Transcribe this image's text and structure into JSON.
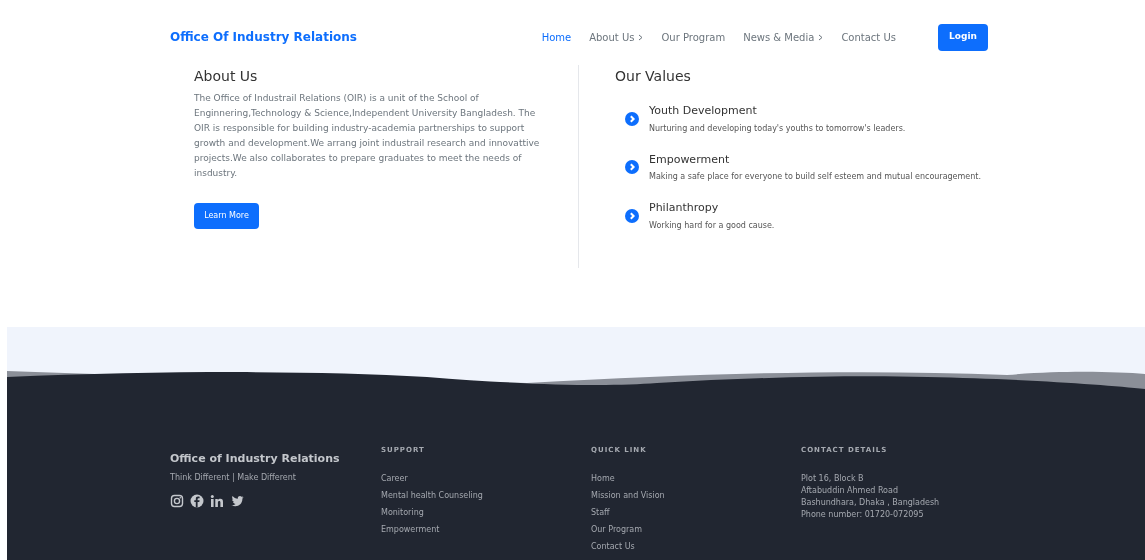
{
  "header": {
    "brand": "Office Of Industry Relations",
    "nav": [
      {
        "label": "Home",
        "selected": true,
        "dropdown": false
      },
      {
        "label": "About Us",
        "selected": false,
        "dropdown": true
      },
      {
        "label": "Our Program",
        "selected": false,
        "dropdown": false
      },
      {
        "label": "News & Media",
        "selected": false,
        "dropdown": true
      },
      {
        "label": "Contact Us",
        "selected": false,
        "dropdown": false
      }
    ],
    "login": "Login"
  },
  "about": {
    "title": "About Us",
    "text": "The Office of Industrail Relations (OIR) is a unit of the School of Enginnering,Technology & Science,Independent University Bangladesh. The OIR is responsible for building industry-academia partnerships to support growth and development.We arrang joint industrail research and innovattive projects.We also collaborates to prepare graduates to meet the needs of insdustry.",
    "button": "Learn More"
  },
  "values": {
    "title": "Our Values",
    "items": [
      {
        "title": "Youth Development",
        "text": "Nurturing and developing today's youths to tomorrow's leaders."
      },
      {
        "title": "Empowerment",
        "text": "Making a safe place for everyone to build self esteem and mutual encouragement."
      },
      {
        "title": "Philanthropy",
        "text": "Working hard for a good cause."
      }
    ]
  },
  "footer": {
    "brand": "Office of Industry Relations",
    "tagline": "Think Different | Make Different",
    "social": [
      {
        "kind": "instagram"
      },
      {
        "kind": "facebook"
      },
      {
        "kind": "linkedin"
      },
      {
        "kind": "twitter"
      }
    ],
    "columns": [
      {
        "heading": "SUPPORT",
        "kind": "links",
        "items": [
          "Career",
          "Mental health Counseling",
          "Monitoring",
          "Empowerment"
        ]
      },
      {
        "heading": "QUICK LINK",
        "kind": "links",
        "items": [
          "Home",
          "Mission and Vision",
          "Staff",
          "Our Program",
          "Contact Us"
        ]
      },
      {
        "heading": "CONTACT DETAILS",
        "kind": "text",
        "items": [
          "Plot 16, Block B",
          "Aftabuddin Ahmed Road",
          "Bashundhara, Dhaka , Bangladesh",
          "Phone number: 01720-072095"
        ]
      }
    ]
  }
}
